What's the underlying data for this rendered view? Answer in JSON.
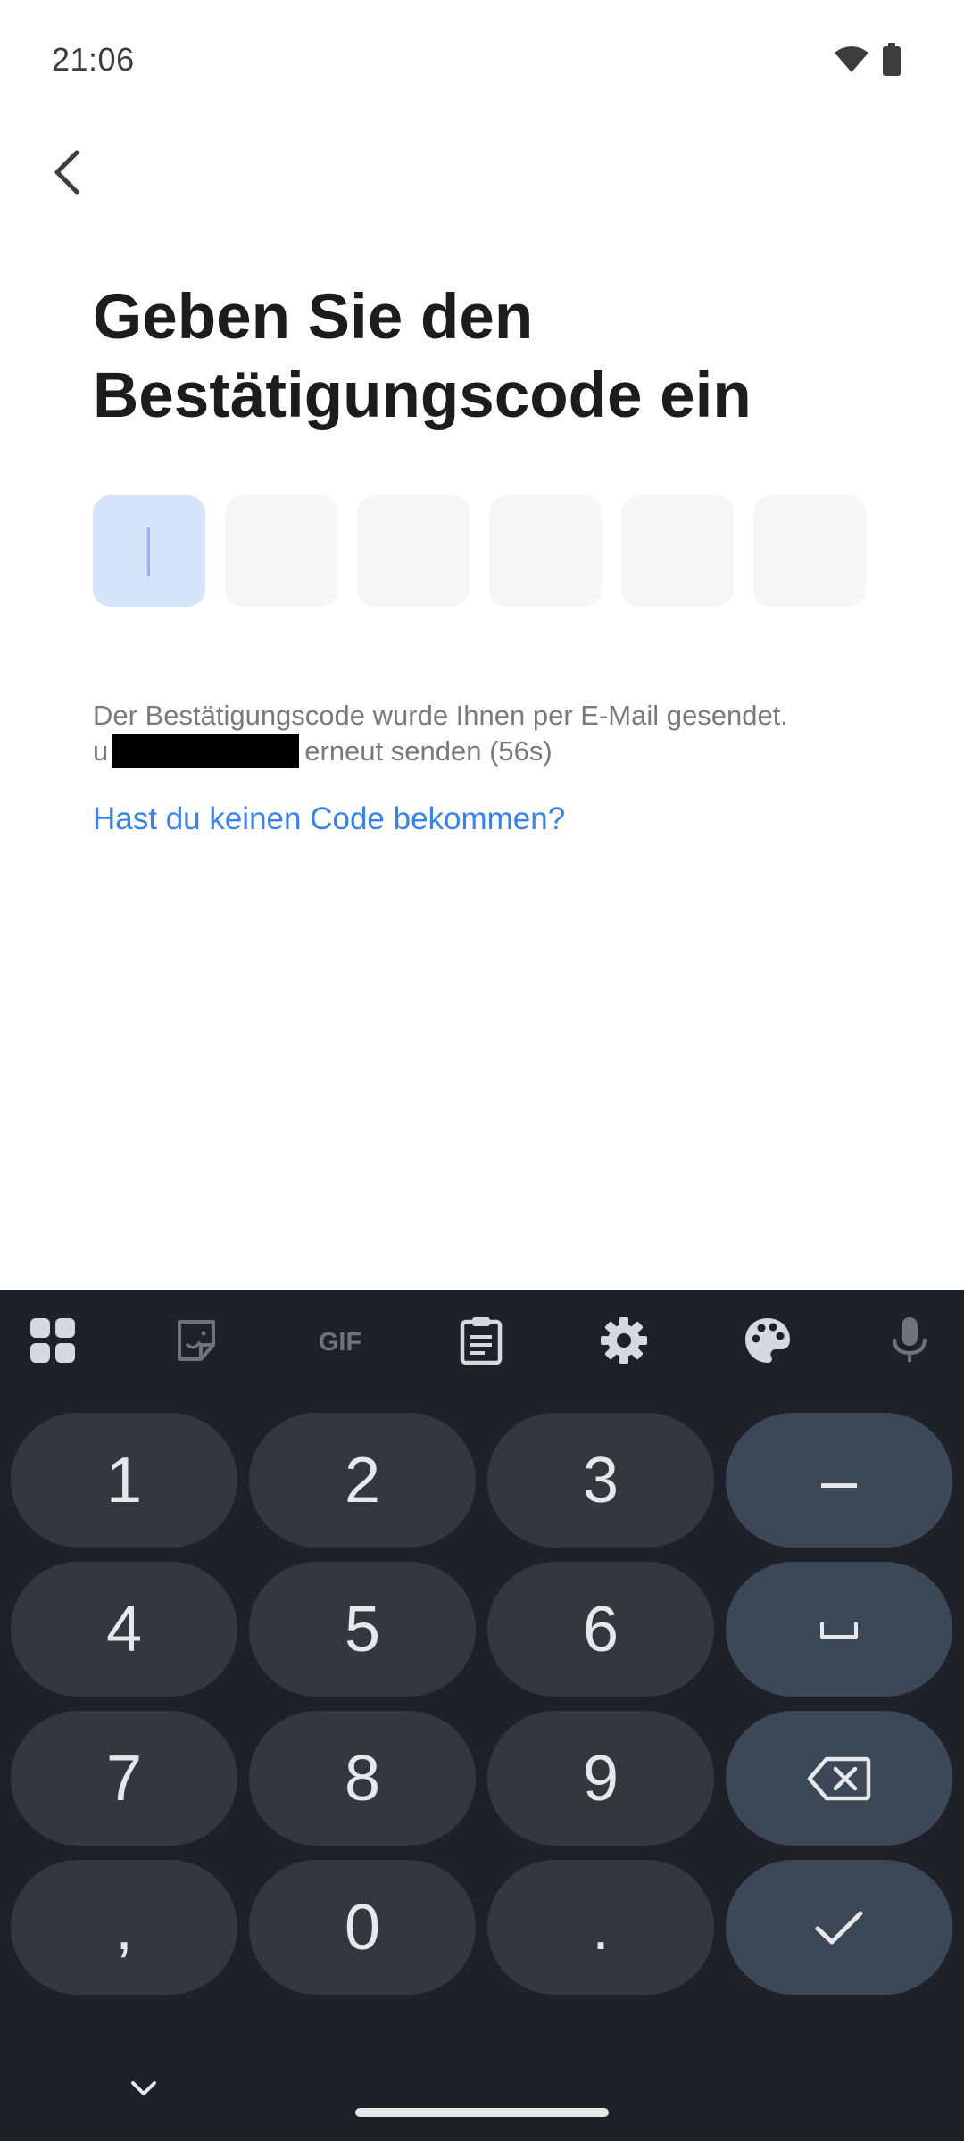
{
  "status_bar": {
    "time": "21:06",
    "icons": [
      "wifi-icon",
      "battery-icon"
    ]
  },
  "header": {
    "back_icon": "chevron-left-icon"
  },
  "title": "Geben Sie den Bestätigungscode ein",
  "code_input": {
    "digits": [
      "",
      "",
      "",
      "",
      "",
      ""
    ],
    "active_index": 0
  },
  "info": {
    "line1": "Der Bestätigungscode wurde Ihnen per E-Mail gesendet.",
    "line2_prefix": "u",
    "line2_suffix": "erneut senden (56s)"
  },
  "help_link": "Hast du keinen Code bekommen?",
  "keyboard": {
    "toolbar": [
      "apps-grid-icon",
      "sticker-icon",
      "GIF",
      "clipboard-icon",
      "gear-icon",
      "palette-icon",
      "microphone-icon"
    ],
    "keys": {
      "k1": "1",
      "k2": "2",
      "k3": "3",
      "minus": "–",
      "k4": "4",
      "k5": "5",
      "k6": "6",
      "space": "␣",
      "k7": "7",
      "k8": "8",
      "k9": "9",
      "comma": ",",
      "k0": "0",
      "period": "."
    }
  },
  "colors": {
    "accent": "#3b82e6",
    "active_box": "#d6e4fb",
    "keyboard_bg": "#1e2127",
    "key_bg": "#34383e",
    "func_key_bg": "#3c4758"
  }
}
